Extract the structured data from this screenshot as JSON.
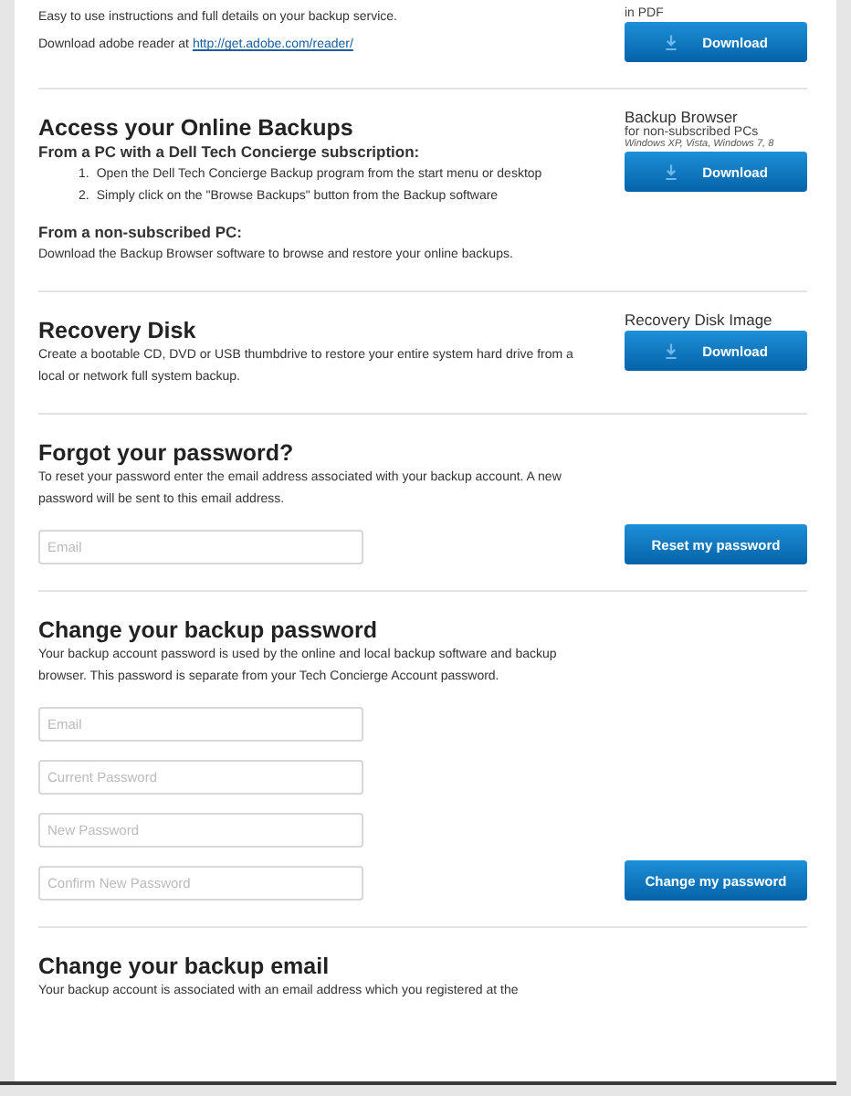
{
  "sections": [
    {
      "kind": "download",
      "body": [
        {
          "kind": "paragraph",
          "text": "Easy to use instructions and full details on your backup service."
        },
        {
          "kind": "link_paragraph",
          "text": "Download adobe reader at",
          "link": "http://get.adobe.com/reader/"
        }
      ],
      "aside": {
        "lines": [
          {
            "kind": "caption",
            "text": "in PDF"
          }
        ],
        "button": "Download"
      }
    },
    {
      "kind": "download",
      "title": "Access your Online Backups",
      "body": [
        {
          "kind": "subheading",
          "text": "From a PC with a Dell Tech Concierge subscription:"
        },
        {
          "kind": "steps",
          "items": [
            {
              "number": "1.",
              "text": "Open the Dell Tech Concierge Backup program from the start menu or desktop"
            },
            {
              "number": "2.",
              "text": "Simply click on the \"Browse Backups\" button from the Backup software"
            }
          ]
        },
        {
          "kind": "subheading",
          "text": "From a non-subscribed PC:"
        },
        {
          "kind": "paragraph",
          "text": "Download the Backup Browser software to browse and restore your online backups."
        }
      ],
      "aside": {
        "lines": [
          {
            "kind": "heading",
            "text": "Backup Browser"
          },
          {
            "kind": "caption",
            "text": "for non-subscribed PCs"
          },
          {
            "kind": "note",
            "text": "Windows XP, Vista, Windows 7, 8"
          }
        ],
        "button": "Download"
      }
    },
    {
      "kind": "download",
      "title": "Recovery Disk",
      "body": [
        {
          "kind": "paragraph",
          "text": "Create a bootable CD, DVD or USB thumbdrive to restore your entire system hard drive from a local or network full system backup."
        }
      ],
      "aside": {
        "lines": [
          {
            "kind": "heading",
            "text": "Recovery Disk Image"
          }
        ],
        "button": "Download"
      }
    },
    {
      "kind": "form",
      "title": "Forgot your password?",
      "body": [
        {
          "kind": "paragraph",
          "text": "To reset your password enter the email address associated with your backup account. A new password will be sent to this email address."
        },
        {
          "kind": "field",
          "placeholder": "Email"
        }
      ],
      "aside": {
        "button": "Reset my password"
      }
    },
    {
      "kind": "form",
      "title": "Change your backup password",
      "body": [
        {
          "kind": "paragraph",
          "text": "Your backup account password is used by the online and local backup software and backup browser. This password is separate from your Tech Concierge Account password."
        },
        {
          "kind": "field",
          "placeholder": "Email"
        },
        {
          "kind": "field",
          "placeholder": "Current Password"
        },
        {
          "kind": "field",
          "placeholder": "New Password"
        },
        {
          "kind": "field",
          "placeholder": "Confirm New Password"
        }
      ],
      "aside": {
        "button": "Change my password"
      }
    },
    {
      "kind": "form",
      "title": "Change your backup email",
      "body": [
        {
          "kind": "paragraph",
          "text": "Your backup account is associated with an email address which you registered at the"
        }
      ]
    }
  ]
}
